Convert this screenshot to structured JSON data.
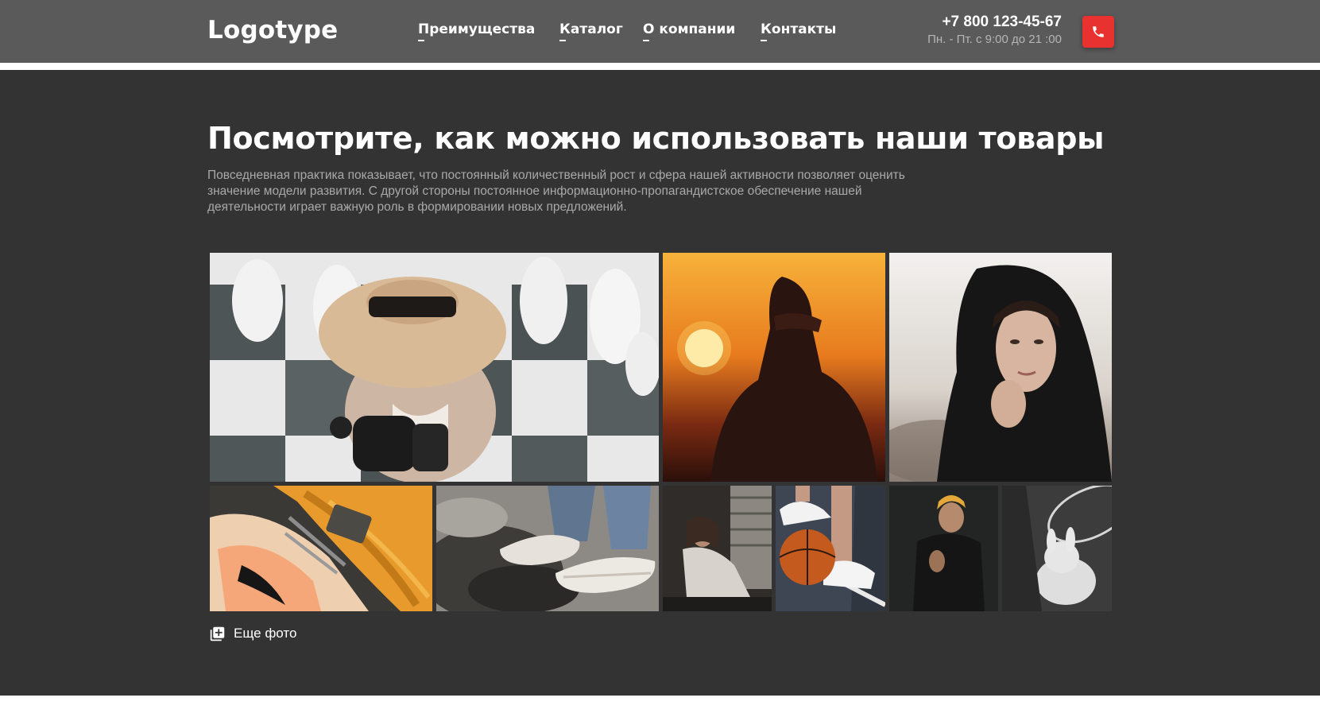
{
  "header": {
    "logo": "Logotype",
    "nav": [
      {
        "label": "Преимущества"
      },
      {
        "label": "Каталог"
      },
      {
        "label": "О компании"
      },
      {
        "label": "Контакты"
      }
    ],
    "phone": "+7 800 123-45-67",
    "hours": "Пн. - Пт. с 9:00 до 21 :00",
    "call_icon": "phone-icon",
    "call_button_color": "#e8322f"
  },
  "main": {
    "title": "Посмотрите, как можно использовать наши товары",
    "description_lines": [
      "Повседневная практика показывает, что постоянный количественный рост и сфера нашей активности позволяет оценить",
      "значение модели развития. С другой стороны постоянное информационно-пропагандистское обеспечение нашей",
      "деятельности играет важную роль в формировании новых предложений."
    ],
    "gallery_photos": [
      "woman-in-straw-hat-on-chessboard",
      "silhouette-at-sunset",
      "woman-in-black-hood",
      "sneakers-closeup",
      "sneakers-in-puddle",
      "woman-sitting-by-window",
      "sneakers-on-basketball",
      "man-with-dyed-hair",
      "plush-toy-black-and-white"
    ],
    "more_photos_label": "Еще фото",
    "more_photos_icon": "add-photo-icon"
  },
  "colors": {
    "header_bg": "#5a5a5a",
    "main_bg": "#333333",
    "accent": "#e8322f"
  }
}
